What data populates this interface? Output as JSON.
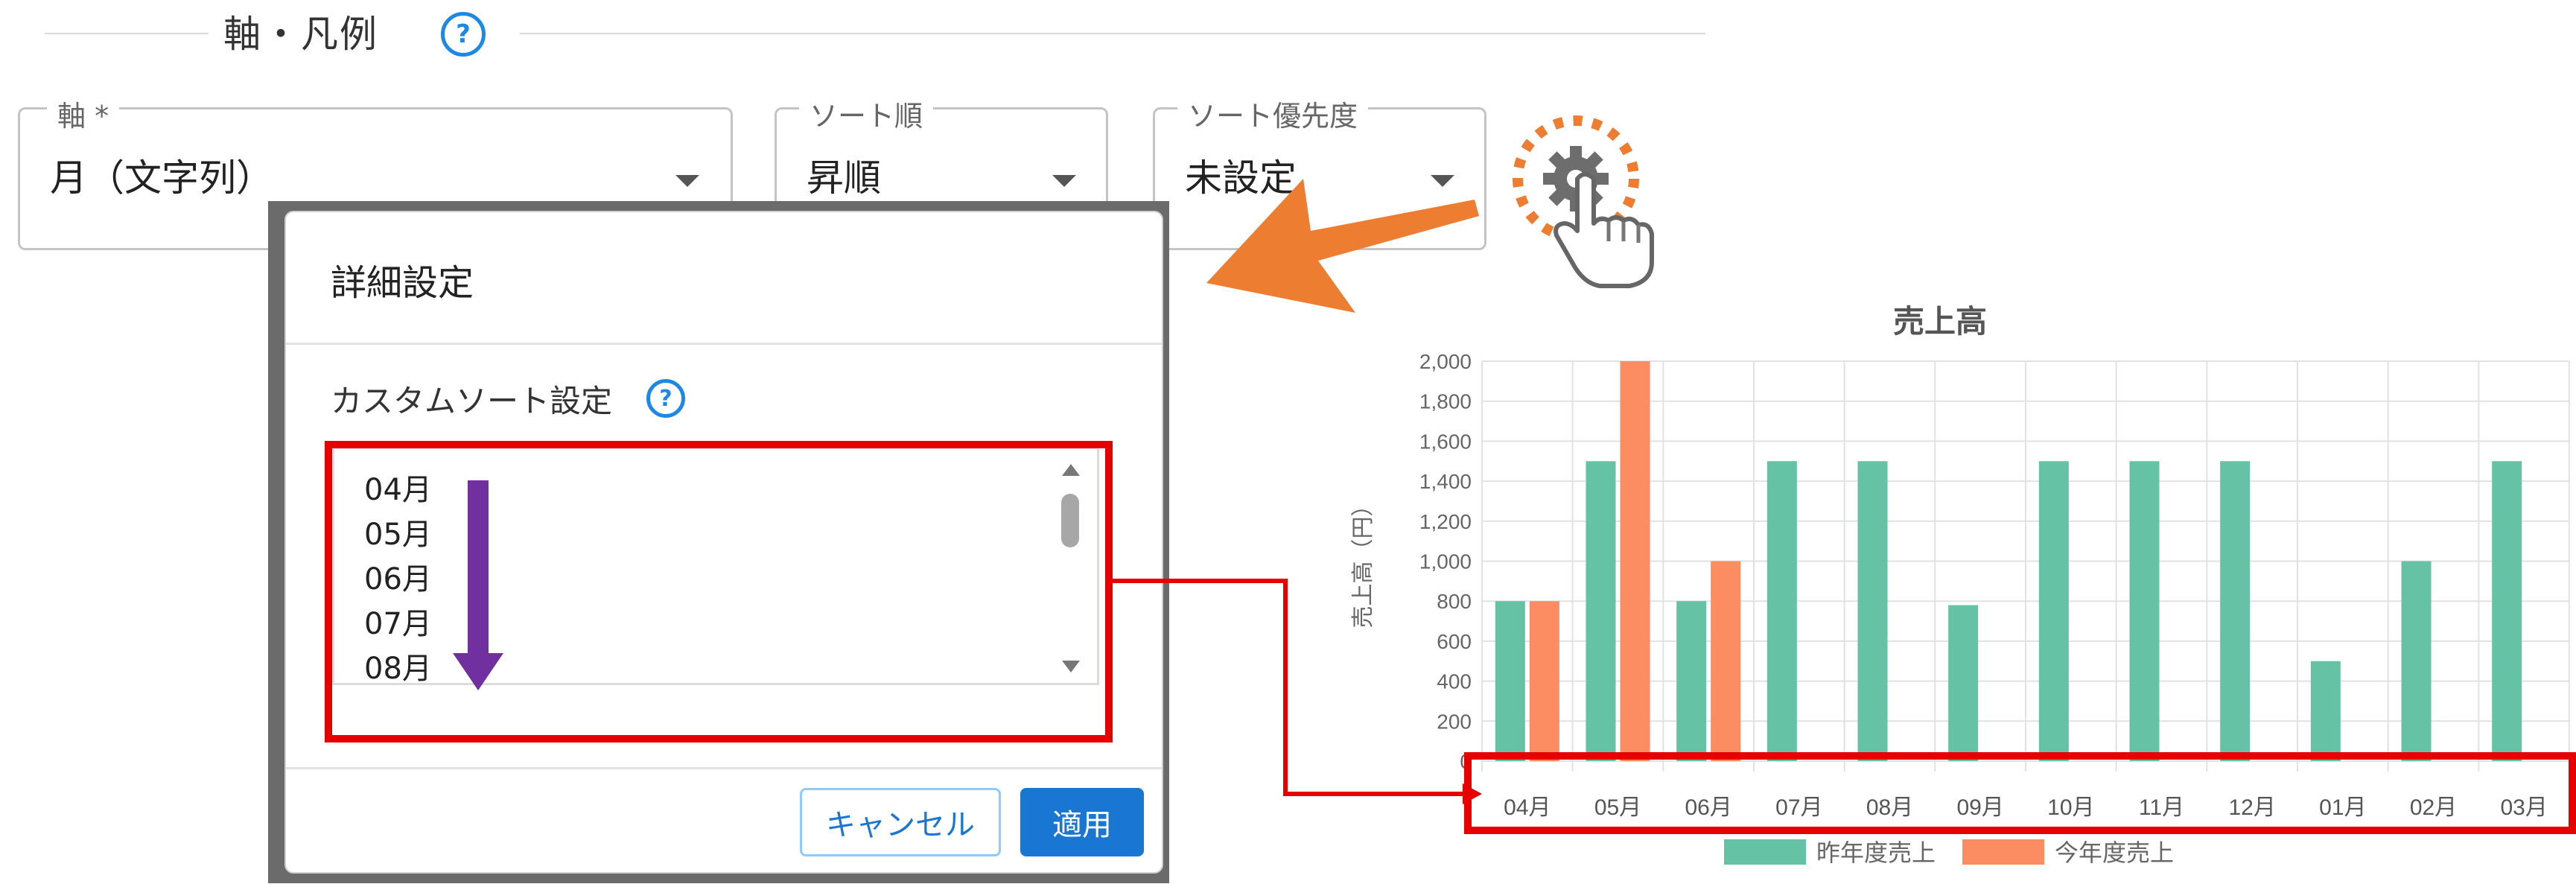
{
  "section": {
    "title": "軸・凡例",
    "help": "?"
  },
  "fields": {
    "axis": {
      "label": "軸 *",
      "value": "月（文字列）"
    },
    "sort_order": {
      "label": "ソート順",
      "value": "昇順"
    },
    "sort_priority": {
      "label": "ソート優先度",
      "value": "未設定"
    }
  },
  "dialog": {
    "title": "詳細設定",
    "custom_sort_label": "カスタムソート設定",
    "help": "?",
    "list_items": [
      "04月",
      "05月",
      "06月",
      "07月",
      "08月"
    ],
    "cancel_label": "キャンセル",
    "apply_label": "適用"
  },
  "icons": {
    "gear": "gear-icon",
    "pointer": "hand-pointer-icon",
    "arrow": "orange-arrow-icon",
    "down_arrow": "purple-down-arrow-icon"
  },
  "colors": {
    "highlight": "#e60000",
    "accent": "#1976d2",
    "series_prev": "#66c2a5",
    "series_curr": "#fc8d62",
    "purple_arrow": "#7030a0",
    "orange_arrow": "#ed7d31"
  },
  "chart_data": {
    "type": "bar",
    "title": "売上高",
    "ylabel": "売上高（円）",
    "xlabel": "",
    "categories": [
      "04月",
      "05月",
      "06月",
      "07月",
      "08月",
      "09月",
      "10月",
      "11月",
      "12月",
      "01月",
      "02月",
      "03月"
    ],
    "series": [
      {
        "name": "昨年度売上",
        "color": "#66c2a5",
        "values": [
          800,
          1500,
          800,
          1500,
          1500,
          780,
          1500,
          1500,
          1500,
          500,
          1000,
          1500
        ]
      },
      {
        "name": "今年度売上",
        "color": "#fc8d62",
        "values": [
          800,
          2000,
          1000,
          null,
          null,
          null,
          null,
          null,
          null,
          null,
          null,
          null
        ]
      }
    ],
    "ylim": [
      0,
      2000
    ],
    "yticks": [
      "2,000",
      "1,800",
      "1,600",
      "1,400",
      "1,200",
      "1,000",
      "800",
      "600",
      "400",
      "200",
      "0"
    ],
    "grid": true,
    "legend": "bottom"
  }
}
